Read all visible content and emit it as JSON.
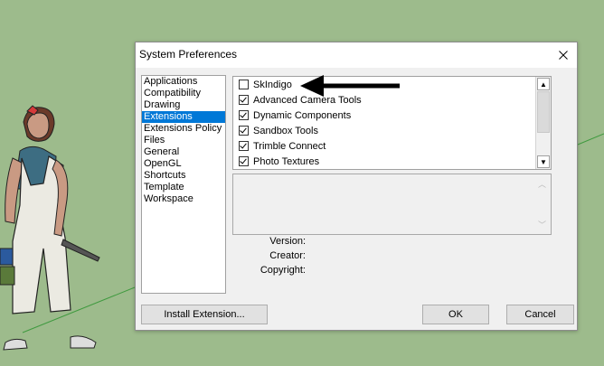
{
  "dialog": {
    "title": "System Preferences",
    "close_glyph": "✕"
  },
  "categories": [
    {
      "label": "Applications",
      "selected": false
    },
    {
      "label": "Compatibility",
      "selected": false
    },
    {
      "label": "Drawing",
      "selected": false
    },
    {
      "label": "Extensions",
      "selected": true
    },
    {
      "label": "Extensions Policy",
      "selected": false
    },
    {
      "label": "Files",
      "selected": false
    },
    {
      "label": "General",
      "selected": false
    },
    {
      "label": "OpenGL",
      "selected": false
    },
    {
      "label": "Shortcuts",
      "selected": false
    },
    {
      "label": "Template",
      "selected": false
    },
    {
      "label": "Workspace",
      "selected": false
    }
  ],
  "extensions": [
    {
      "label": "SkIndigo",
      "checked": false
    },
    {
      "label": "Advanced Camera Tools",
      "checked": true
    },
    {
      "label": "Dynamic Components",
      "checked": true
    },
    {
      "label": "Sandbox Tools",
      "checked": true
    },
    {
      "label": "Trimble Connect",
      "checked": true
    },
    {
      "label": "Photo Textures",
      "checked": true
    }
  ],
  "info": {
    "version_label": "Version:",
    "creator_label": "Creator:",
    "copyright_label": "Copyright:"
  },
  "buttons": {
    "install": "Install Extension...",
    "ok": "OK",
    "cancel": "Cancel"
  },
  "colors": {
    "background": "#9dbb8c",
    "selection": "#0078d7",
    "annotation_arrow": "#000000"
  }
}
